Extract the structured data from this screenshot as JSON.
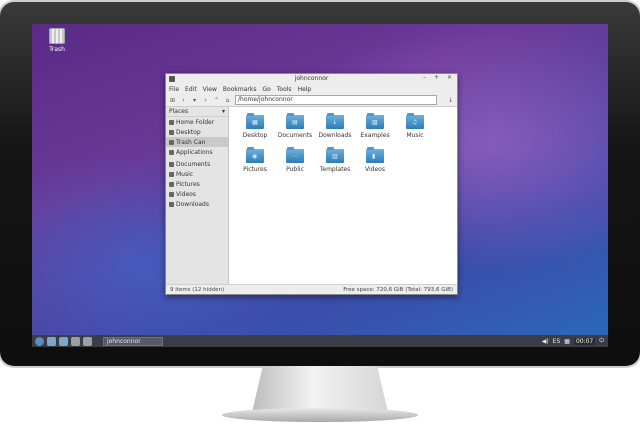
{
  "desktop": {
    "icon_label": "Trash"
  },
  "window": {
    "title": "johnconnor",
    "buttons": [
      "–",
      "+",
      "×"
    ],
    "menu": [
      "File",
      "Edit",
      "View",
      "Bookmarks",
      "Go",
      "Tools",
      "Help"
    ],
    "path": "/home/johnconnor",
    "sidebar_header": "Places",
    "sidebar_group1": [
      {
        "label": "Home Folder"
      },
      {
        "label": "Desktop"
      },
      {
        "label": "Trash Can"
      },
      {
        "label": "Applications"
      }
    ],
    "sidebar_group2": [
      {
        "label": "Documents"
      },
      {
        "label": "Music"
      },
      {
        "label": "Pictures"
      },
      {
        "label": "Videos"
      },
      {
        "label": "Downloads"
      }
    ],
    "files": [
      {
        "name": "Desktop",
        "icon": "▦"
      },
      {
        "name": "Documents",
        "icon": "▤"
      },
      {
        "name": "Downloads",
        "icon": "↓"
      },
      {
        "name": "Examples",
        "icon": "▨"
      },
      {
        "name": "Music",
        "icon": "♫"
      },
      {
        "name": "Pictures",
        "icon": "◉"
      },
      {
        "name": "Public",
        "icon": "⋯"
      },
      {
        "name": "Templates",
        "icon": "▥"
      },
      {
        "name": "Videos",
        "icon": "▮"
      }
    ],
    "status_left": "9 items (12 hidden)",
    "status_right": "Free space: 720,6 GiB (Total: 793,6 GiB)"
  },
  "taskbar": {
    "task_label": "johnconnor",
    "keyboard_layout": "ES",
    "clock": "00:07"
  }
}
